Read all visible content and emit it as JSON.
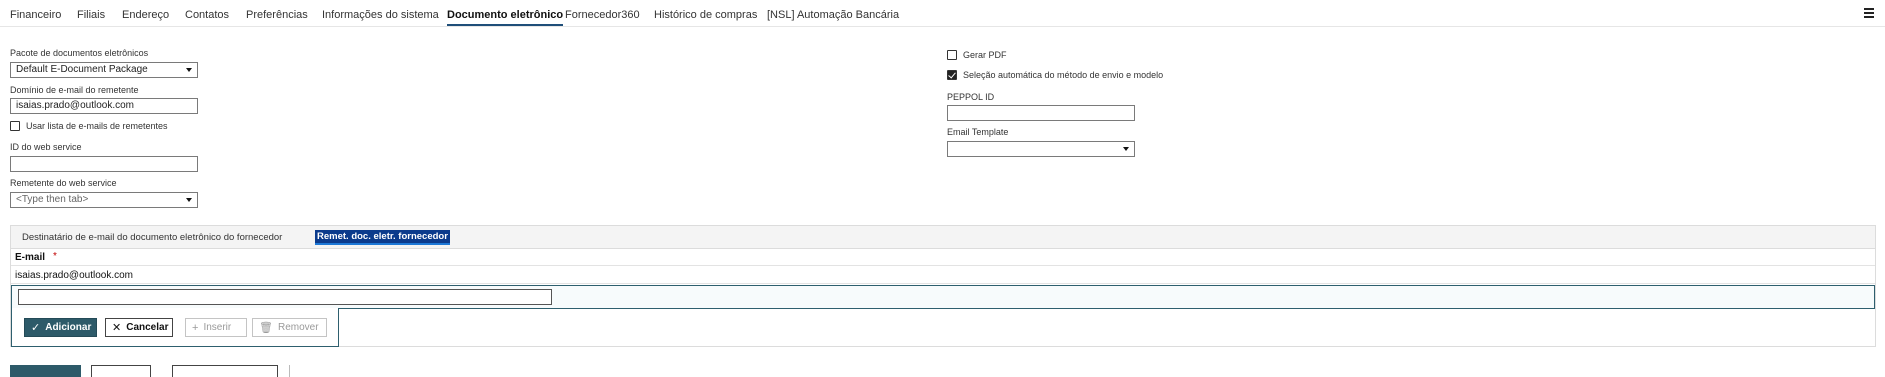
{
  "tabs": [
    {
      "label": "Financeiro"
    },
    {
      "label": "Filiais"
    },
    {
      "label": "Endereço"
    },
    {
      "label": "Contatos"
    },
    {
      "label": "Preferências"
    },
    {
      "label": "Informações do sistema"
    },
    {
      "label": "Documento eletrônico"
    },
    {
      "label": "Fornecedor360"
    },
    {
      "label": "Histórico de compras"
    },
    {
      "label": "[NSL] Automação Bancária"
    }
  ],
  "form": {
    "pacote_label": "Pacote de documentos eletrônicos",
    "pacote_value": "Default E-Document Package",
    "dominio_label": "Domínio de e-mail do remetente",
    "dominio_value": "isaias.prado@outlook.com",
    "usar_lista_label": "Usar lista de e-mails de remetentes",
    "ws_id_label": "ID do web service",
    "ws_id_value": "",
    "ws_remetente_label": "Remetente do web service",
    "ws_remetente_placeholder": "<Type then tab>",
    "gerar_pdf_label": "Gerar PDF",
    "selecao_auto_label": "Seleção automática do método de envio e modelo",
    "peppol_label": "PEPPOL ID",
    "peppol_value": "",
    "email_template_label": "Email Template",
    "email_template_value": ""
  },
  "subtabs": [
    {
      "label": "Destinatário de e-mail do documento eletrônico do fornecedor"
    },
    {
      "label": "Remet. doc. eletr. fornecedor"
    }
  ],
  "grid": {
    "header": "E-mail",
    "required_mark": "*",
    "rows": [
      "isaias.prado@outlook.com"
    ],
    "edit_value": ""
  },
  "actions": {
    "adicionar": "Adicionar",
    "cancelar": "Cancelar",
    "inserir": "Inserir",
    "remover": "Remover"
  },
  "colors": {
    "primary": "#2d5a69",
    "active_tab_underline": "#1f4e79",
    "subtab_selected": "#0b3b8c",
    "required": "#c00000"
  }
}
